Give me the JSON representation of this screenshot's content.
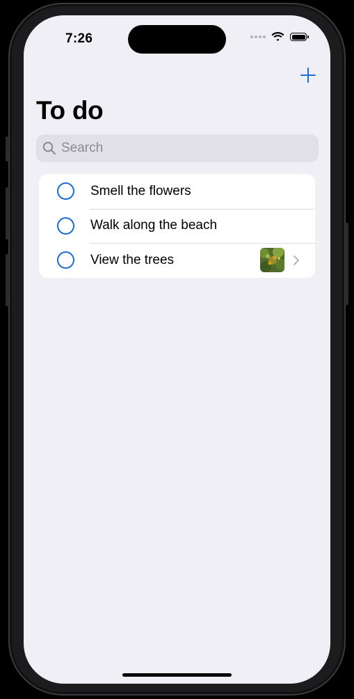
{
  "status_bar": {
    "time": "7:26"
  },
  "nav": {
    "title": "To do",
    "add_icon": "plus-icon"
  },
  "search": {
    "placeholder": "Search",
    "value": ""
  },
  "todos": [
    {
      "label": "Smell the flowers",
      "completed": false,
      "has_image": false
    },
    {
      "label": "Walk along the beach",
      "completed": false,
      "has_image": false
    },
    {
      "label": "View the trees",
      "completed": false,
      "has_image": true
    }
  ],
  "colors": {
    "accent": "#1b6ed6",
    "background": "#f0eff5",
    "search_bg": "#e1e0e7"
  }
}
